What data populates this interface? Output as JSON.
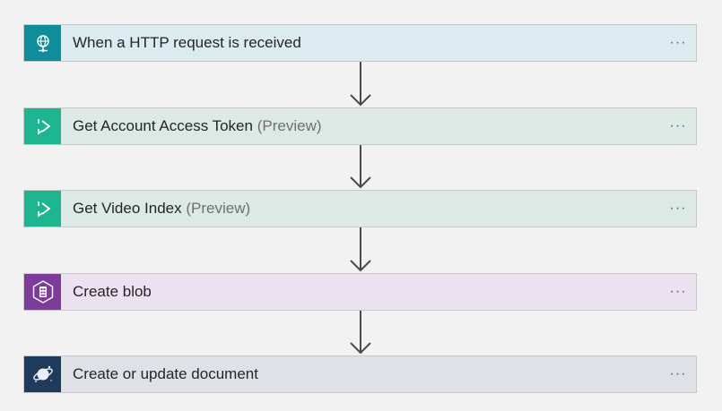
{
  "steps": [
    {
      "title": "When a HTTP request is received",
      "suffix": "",
      "icon": "http-request-globe-icon",
      "background": "#dcebef",
      "icon_color": "#0f8d9b",
      "menu": "···"
    },
    {
      "title": "Get Account Access Token",
      "suffix": "(Preview)",
      "icon": "video-indexer-play-icon",
      "background": "#dde9e5",
      "icon_color": "#1db58f",
      "menu": "···"
    },
    {
      "title": "Get Video Index",
      "suffix": "(Preview)",
      "icon": "video-indexer-play-icon",
      "background": "#dde9e5",
      "icon_color": "#1db58f",
      "menu": "···"
    },
    {
      "title": "Create blob",
      "suffix": "",
      "icon": "blob-storage-hexagon-icon",
      "background": "#ece1f0",
      "icon_color": "#7d3c99",
      "menu": "···"
    },
    {
      "title": "Create or update document",
      "suffix": "",
      "icon": "cosmos-db-planet-icon",
      "background": "#dee2e7",
      "icon_color": "#1f3b5c",
      "menu": "···"
    }
  ],
  "arrow_color": "#4a4a4a"
}
